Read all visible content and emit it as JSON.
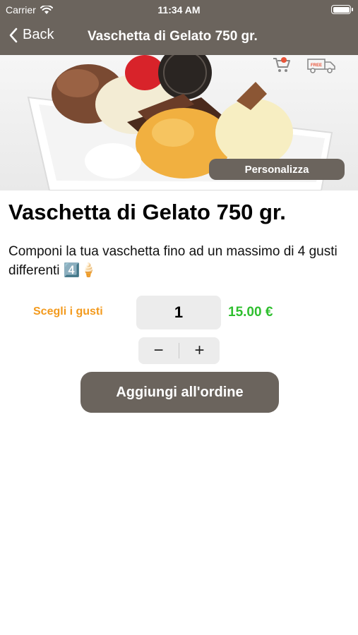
{
  "status_bar": {
    "carrier": "Carrier",
    "time": "11:34 AM"
  },
  "nav": {
    "back_label": "Back",
    "title": "Vaschetta di Gelato 750 gr."
  },
  "hero": {
    "personalizza_label": "Personalizza",
    "truck_badge": "FREE"
  },
  "product": {
    "title": "Vaschetta di Gelato 750 gr.",
    "description": "Componi la tua vaschetta fino ad un massimo di 4 gusti differenti 4️⃣🍦",
    "choose_flavors_label": "Scegli i gusti",
    "quantity": "1",
    "price": "15.00 €"
  },
  "stepper": {
    "minus": "−",
    "plus": "+"
  },
  "actions": {
    "add_to_order_label": "Aggiungi all'ordine"
  },
  "colors": {
    "brand": "#6b645d",
    "price": "#2fbf2f",
    "accent": "#f39a1d"
  }
}
